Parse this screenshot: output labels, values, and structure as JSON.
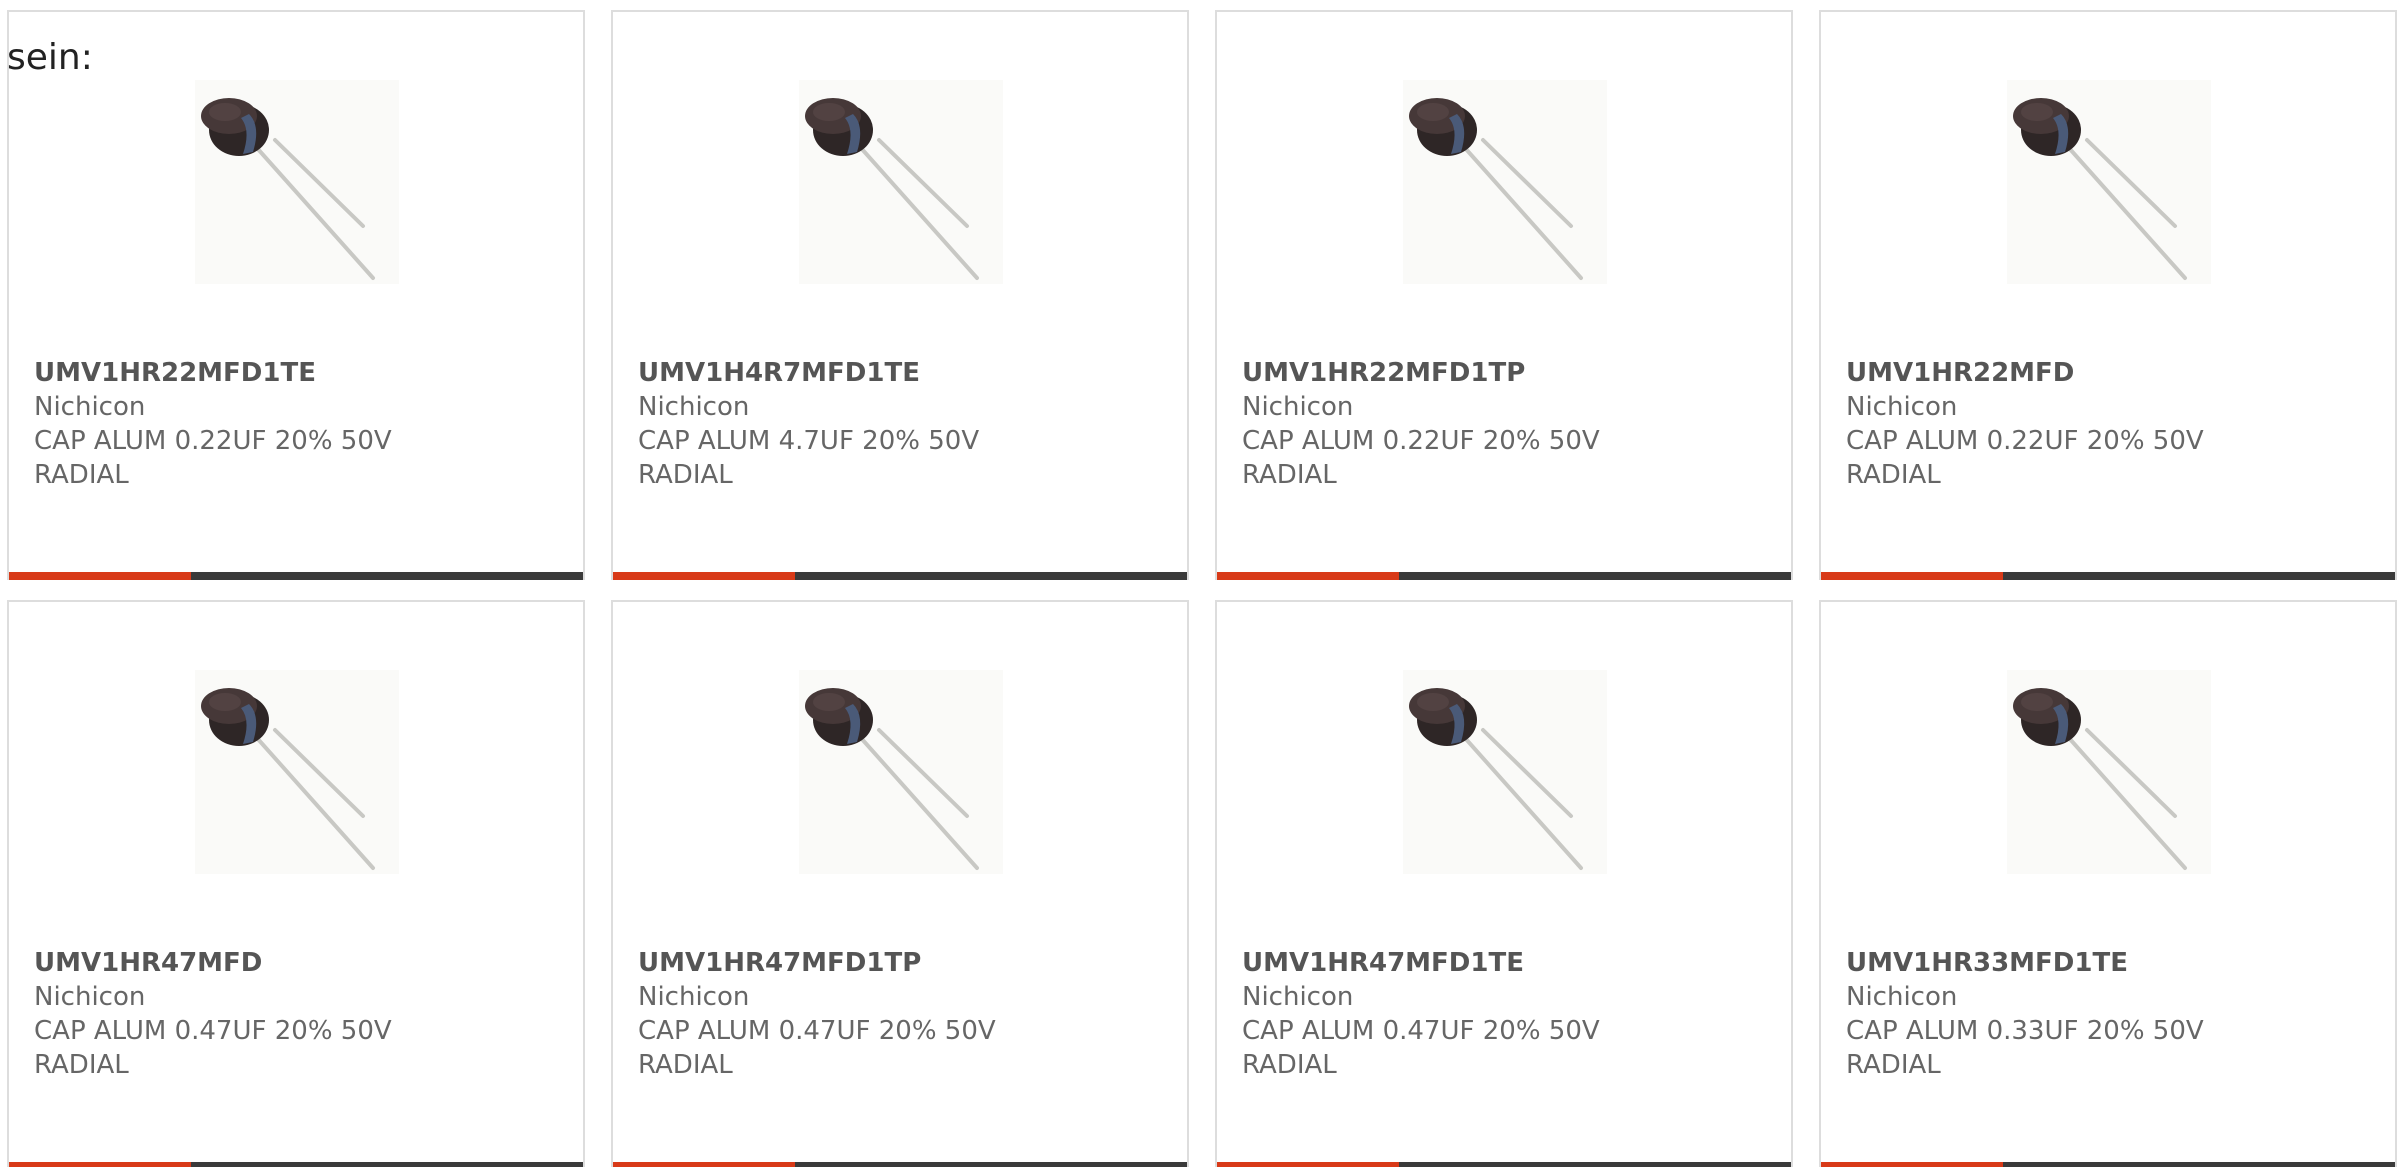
{
  "intro_text": "sein:",
  "colors": {
    "accent": "#d83a18",
    "bar": "#3a3a3a",
    "border": "#dddddd",
    "text": "#666666"
  },
  "products": [
    {
      "part_number": "UMV1HR22MFD1TE",
      "manufacturer": "Nichicon",
      "description": "CAP ALUM 0.22UF 20% 50V RADIAL",
      "image": "radial-capacitor-image"
    },
    {
      "part_number": "UMV1H4R7MFD1TE",
      "manufacturer": "Nichicon",
      "description": "CAP ALUM 4.7UF 20% 50V RADIAL",
      "image": "radial-capacitor-image"
    },
    {
      "part_number": "UMV1HR22MFD1TP",
      "manufacturer": "Nichicon",
      "description": "CAP ALUM 0.22UF 20% 50V RADIAL",
      "image": "radial-capacitor-image"
    },
    {
      "part_number": "UMV1HR22MFD",
      "manufacturer": "Nichicon",
      "description": "CAP ALUM 0.22UF 20% 50V RADIAL",
      "image": "radial-capacitor-image"
    },
    {
      "part_number": "UMV1HR47MFD",
      "manufacturer": "Nichicon",
      "description": "CAP ALUM 0.47UF 20% 50V RADIAL",
      "image": "radial-capacitor-image"
    },
    {
      "part_number": "UMV1HR47MFD1TP",
      "manufacturer": "Nichicon",
      "description": "CAP ALUM 0.47UF 20% 50V RADIAL",
      "image": "radial-capacitor-image"
    },
    {
      "part_number": "UMV1HR47MFD1TE",
      "manufacturer": "Nichicon",
      "description": "CAP ALUM 0.47UF 20% 50V RADIAL",
      "image": "radial-capacitor-image"
    },
    {
      "part_number": "UMV1HR33MFD1TE",
      "manufacturer": "Nichicon",
      "description": "CAP ALUM 0.33UF 20% 50V RADIAL",
      "image": "radial-capacitor-image"
    }
  ]
}
